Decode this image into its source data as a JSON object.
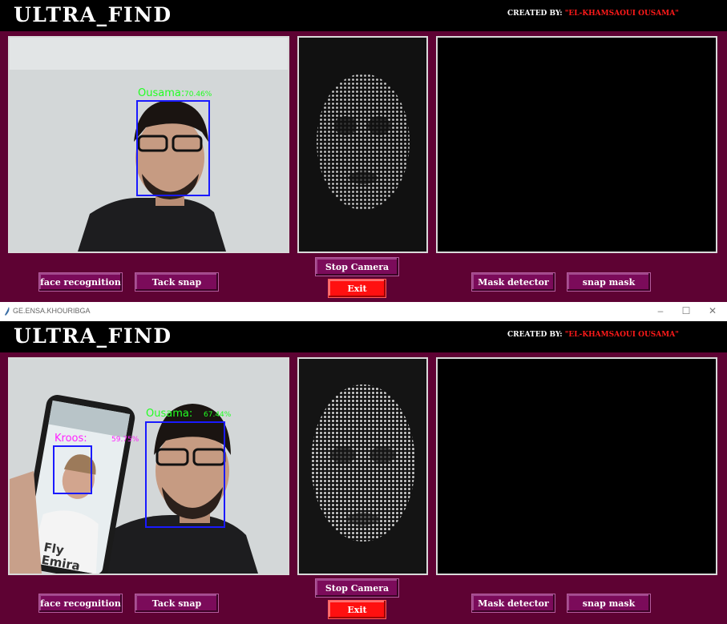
{
  "app": {
    "title": "ULTRA_FIND",
    "credit_prefix": "CREATED BY: ",
    "credit_name": "\"EL-KHAMSAOUI OUSAMA\""
  },
  "window": {
    "title": "GE.ENSA.KHOURIBGA",
    "minimize_icon": "–",
    "maximize_icon": "☐",
    "close_icon": "✕"
  },
  "buttons": {
    "face_recognition": "face recognition",
    "tack_snap": "Tack snap",
    "stop_camera": "Stop Camera",
    "exit": "Exit",
    "mask_detector": "Mask detector",
    "snap_mask": "snap mask"
  },
  "top": {
    "detections": [
      {
        "label": "Ousama:",
        "score": "70.46%",
        "color": "#22ff22"
      }
    ]
  },
  "bottom": {
    "detections": [
      {
        "label": "Ousama:",
        "score": "67.44%",
        "color": "#22ff22"
      },
      {
        "label": "Kroos:",
        "score": "59.75%",
        "color": "#ff22ff"
      }
    ],
    "phone_text": "Fly\nEmira"
  },
  "colors": {
    "background": "#5e0233",
    "button": "#7b0b5a",
    "exit": "#ff1010",
    "box": "#1a1aff"
  }
}
